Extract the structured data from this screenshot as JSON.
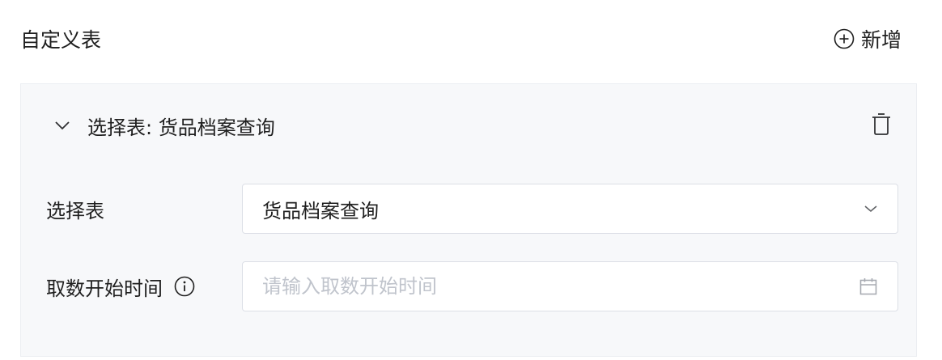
{
  "header": {
    "title": "自定义表",
    "add_label": "新增"
  },
  "panel": {
    "title": "选择表: 货品档案查询",
    "fields": {
      "table": {
        "label": "选择表",
        "value": "货品档案查询"
      },
      "start_time": {
        "label": "取数开始时间",
        "value": "",
        "placeholder": "请输入取数开始时间"
      }
    }
  },
  "icons": {
    "add": "plus-circle-icon",
    "collapse": "chevron-down-icon",
    "delete": "trash-icon",
    "select_arrow": "chevron-down-icon",
    "info": "info-circle-icon",
    "calendar": "calendar-icon"
  },
  "colors": {
    "text": "#1f1f1f",
    "placeholder": "#c0c4cc",
    "panel_bg": "#f7f8fa",
    "border": "#dcdfe6",
    "icon": "#606266"
  }
}
